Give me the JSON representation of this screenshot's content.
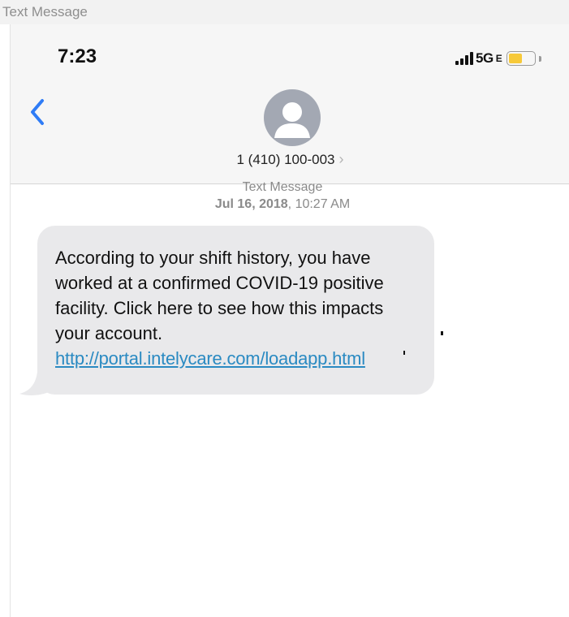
{
  "window": {
    "title": "Text Message"
  },
  "status_bar": {
    "time": "7:23",
    "network": "5G",
    "network_suffix": "E"
  },
  "header": {
    "contact_number": "1 (410) 100-003",
    "chevron": "›"
  },
  "thread": {
    "label": "Text Message",
    "date": "Jul 16, 2018",
    "time": "10:27 AM"
  },
  "message": {
    "line1": "According to your shift history, you have",
    "line2": "worked at a confirmed COVID-19 positive",
    "line3": "facility. Click here to see how this impacts",
    "line4": "your account.",
    "link": "http://portal.intelycare.com/loadapp.html"
  },
  "colors": {
    "link": "#2a8ac2",
    "back_arrow": "#2f7cf6",
    "bubble": "#e9e9eb",
    "battery": "#f7c939",
    "avatar": "#a3a8b3"
  },
  "icons": [
    "back-chevron-icon",
    "contact-avatar-icon",
    "signal-bars-icon",
    "battery-icon",
    "chevron-right-icon"
  ]
}
